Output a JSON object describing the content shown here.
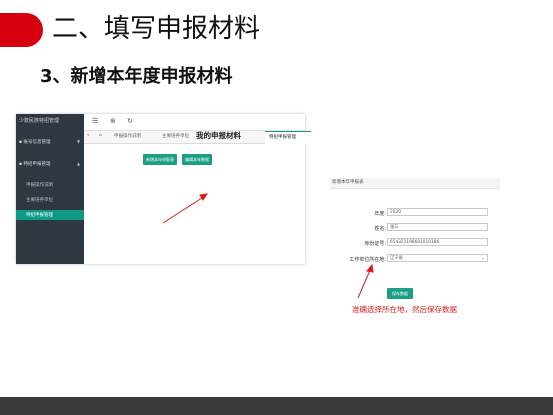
{
  "slide": {
    "title": "二、填写申报材料",
    "subtitle": "3、新增本年度申报材料"
  },
  "app": {
    "brand": "少数民族特招管理",
    "sidebar": {
      "items": [
        {
          "label": "账号信息管理"
        },
        {
          "label": "特招申报管理"
        }
      ],
      "subitems": [
        {
          "label": "申报操作说明"
        },
        {
          "label": "主要培养单位"
        },
        {
          "label": "特招申报管理"
        }
      ]
    },
    "tabs": [
      "申报操作说明",
      "主要培养单位",
      "特招申报管理"
    ],
    "page_title": "我的申报材料",
    "add_button": "新增本年申报表",
    "edit_button": "编辑本年数据"
  },
  "form": {
    "header": "新增本年申报表",
    "fields": [
      {
        "label": "年度:",
        "value": "2020"
      },
      {
        "label": "姓名:",
        "value": "张三"
      },
      {
        "label": "身份证号:",
        "value": "654321198601010186"
      },
      {
        "label": "工作单位所在地:",
        "value": "辽宁省"
      }
    ],
    "save_button": "保存数据"
  },
  "annotation": "准确选择所在地，然后保存数据",
  "colors": {
    "accent_red": "#d7000f",
    "teal": "#1a9e85",
    "sidebar_bg": "#2f3740",
    "arrow_red": "#e0191b"
  }
}
